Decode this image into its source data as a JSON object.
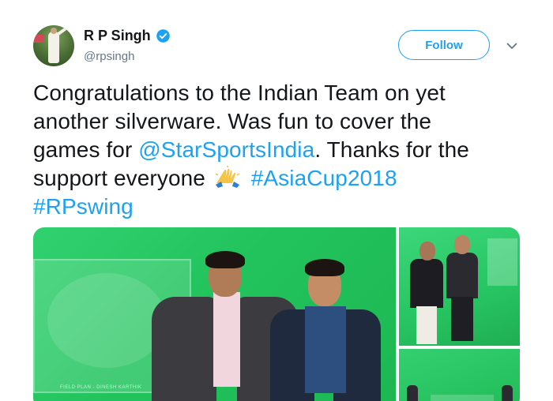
{
  "user": {
    "display_name": "R P Singh",
    "handle": "@rpsingh",
    "verified": true
  },
  "actions": {
    "follow_label": "Follow"
  },
  "tweet": {
    "line1": "Congratulations to the Indian Team on yet",
    "line2": "another silverware. Was fun to cover the",
    "line3_prefix": "games for ",
    "mention": "@StarSportsIndia",
    "line3_suffix": ". Thanks for the",
    "line4_prefix": "support everyone ",
    "emoji": "folded-hands-emoji",
    "hashtag1": "#AsiaCup2018",
    "hashtag2": "#RPswing"
  },
  "colors": {
    "link": "#1da1f2",
    "text": "#14171a",
    "secondary": "#657786",
    "green_screen": "#22c35d"
  },
  "media": {
    "photos": [
      "photo-main",
      "photo-top-right",
      "photo-bottom-right"
    ],
    "field_caption": "FIELD PLAN - DINESH KARTHIK"
  }
}
